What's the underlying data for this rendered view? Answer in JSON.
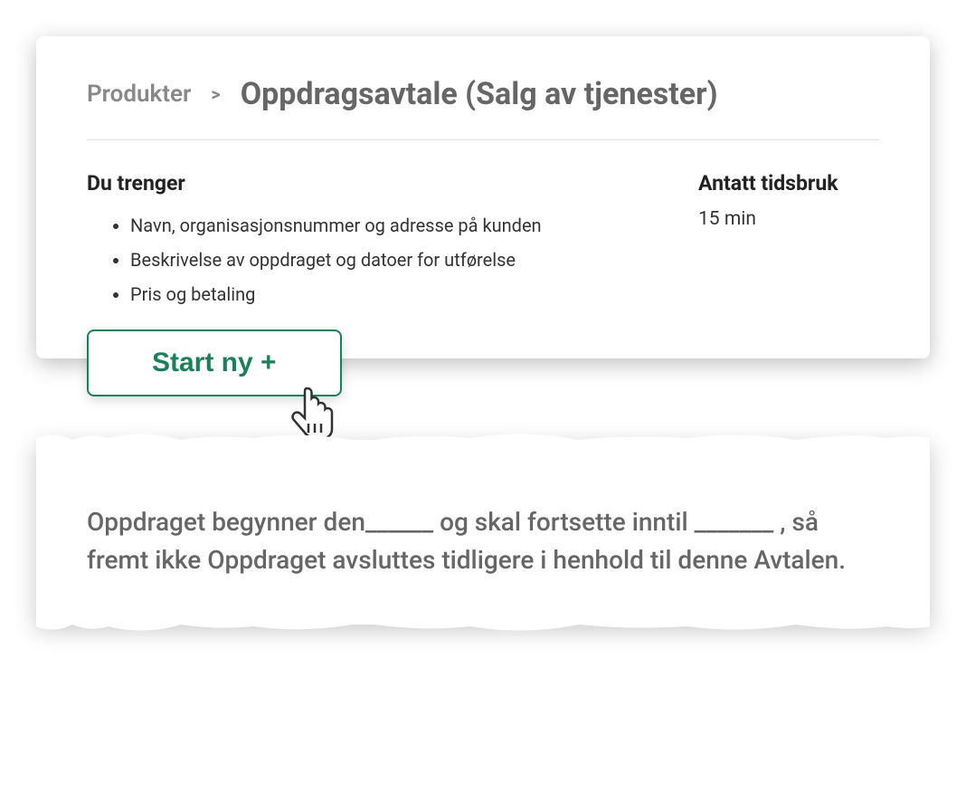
{
  "breadcrumb": {
    "root": "Produkter",
    "separator": ">",
    "current": "Oppdragsavtale (Salg av tjenester)"
  },
  "needs": {
    "heading": "Du trenger",
    "items": [
      "Navn, organisasjonsnummer og adresse på kunden",
      "Beskrivelse av oppdraget og datoer for utførelse",
      "Pris og betaling"
    ]
  },
  "time": {
    "heading": "Antatt tidsbruk",
    "value": "15 min"
  },
  "button": {
    "start_label": "Start ny +"
  },
  "document": {
    "body": "Oppdraget begynner den______ og skal fortsette inntil _______ , så fremt ikke Oppdraget avsluttes tidligere i henhold til denne Avtalen."
  }
}
